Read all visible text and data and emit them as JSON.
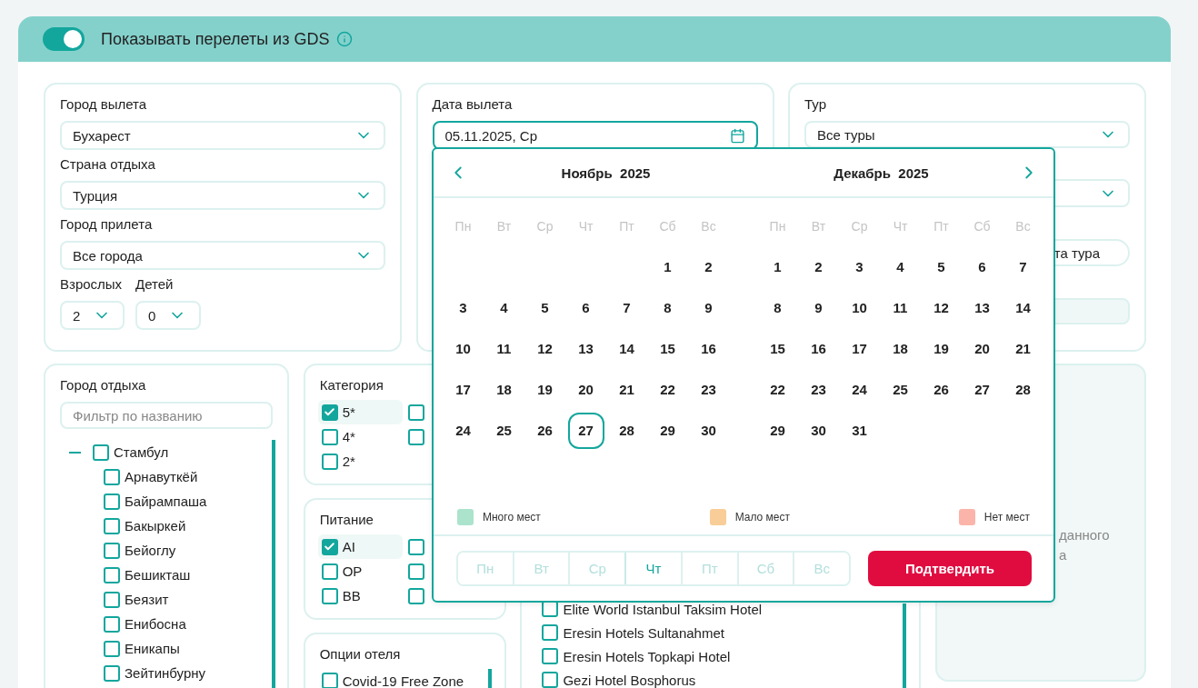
{
  "header": {
    "gds_toggle": {
      "on": true,
      "label": "Показывать перелеты из GDS"
    }
  },
  "search_panel": {
    "fields": [
      {
        "label": "Город вылета",
        "value": "Бухарест"
      },
      {
        "label": "Страна отдыха",
        "value": "Турция"
      },
      {
        "label": "Город прилета",
        "value": "Все города"
      }
    ],
    "adults": {
      "label": "Взрослых",
      "value": "2"
    },
    "children": {
      "label": "Детей",
      "value": "0"
    }
  },
  "date_panel": {
    "label": "Дата вылета",
    "value": "05.11.2025, Ср"
  },
  "tour_panel": {
    "label": "Тур",
    "value": "Все туры",
    "field_3_text": "та тура"
  },
  "resort_city": {
    "label": "Город отдыха",
    "placeholder": "Фильтр по названию",
    "tree": [
      {
        "label": "Стамбул",
        "checked": false,
        "expanded": true,
        "children": [
          {
            "label": "Арнавуткёй",
            "checked": false
          },
          {
            "label": "Байрампаша",
            "checked": false
          },
          {
            "label": "Бакыркей",
            "checked": false
          },
          {
            "label": "Бейоглу",
            "checked": false
          },
          {
            "label": "Бешикташ",
            "checked": false
          },
          {
            "label": "Беязит",
            "checked": false
          },
          {
            "label": "Енибосна",
            "checked": false
          },
          {
            "label": "Еникапы",
            "checked": false
          },
          {
            "label": "Зейтинбурну",
            "checked": false
          }
        ]
      }
    ]
  },
  "category": {
    "label": "Категория",
    "options": [
      {
        "label": "5*",
        "checked": true
      },
      {
        "label": "4*",
        "checked": false
      },
      {
        "label": "2*",
        "checked": false
      }
    ],
    "column_2": [
      {
        "checked": false
      },
      {
        "checked": false
      }
    ]
  },
  "meal": {
    "label": "Питание",
    "options": [
      {
        "label": "AI",
        "checked": true
      },
      {
        "label": "OP",
        "checked": false
      },
      {
        "label": "BB",
        "checked": false
      }
    ],
    "column_2": [
      {
        "checked": false
      },
      {
        "checked": false
      },
      {
        "checked": false
      }
    ]
  },
  "hotel_options": {
    "label": "Опции отеля",
    "options": [
      {
        "label": "Covid-19 Free Zone",
        "checked": false
      }
    ]
  },
  "hotels": [
    {
      "label": "Elite World Istanbul Taksim Hotel",
      "checked": false
    },
    {
      "label": "Eresin Hotels Sultanahmet",
      "checked": false
    },
    {
      "label": "Eresin Hotels Topkapi Hotel",
      "checked": false
    },
    {
      "label": "Gezi Hotel Bosphorus",
      "checked": false
    }
  ],
  "info_panel": {
    "lines": [
      "данного",
      "а"
    ]
  },
  "calendar": {
    "months": [
      {
        "title": "Ноябрь  2025",
        "weekdays": [
          "Пн",
          "Вт",
          "Ср",
          "Чт",
          "Пт",
          "Сб",
          "Вс"
        ],
        "weeks": [
          [
            {
              "day": "1",
              "selected": false
            },
            {
              "day": "2",
              "selected": false
            }
          ],
          [
            {
              "day": "3",
              "selected": false
            },
            {
              "day": "4",
              "selected": false
            },
            {
              "day": "5",
              "selected": false
            },
            {
              "day": "6",
              "selected": false
            },
            {
              "day": "7",
              "selected": false
            },
            {
              "day": "8",
              "selected": false
            },
            {
              "day": "9",
              "selected": false
            }
          ],
          [
            {
              "day": "10",
              "selected": false
            },
            {
              "day": "11",
              "selected": false
            },
            {
              "day": "12",
              "selected": false
            },
            {
              "day": "13",
              "selected": false
            },
            {
              "day": "14",
              "selected": false
            },
            {
              "day": "15",
              "selected": false
            },
            {
              "day": "16",
              "selected": false
            }
          ],
          [
            {
              "day": "17",
              "selected": false
            },
            {
              "day": "18",
              "selected": false
            },
            {
              "day": "19",
              "selected": false
            },
            {
              "day": "20",
              "selected": false
            },
            {
              "day": "21",
              "selected": false
            },
            {
              "day": "22",
              "selected": false
            },
            {
              "day": "23",
              "selected": false
            }
          ],
          [
            {
              "day": "24",
              "selected": false
            },
            {
              "day": "25",
              "selected": false
            },
            {
              "day": "26",
              "selected": false
            },
            {
              "day": "27",
              "selected": true
            },
            {
              "day": "28",
              "selected": false
            },
            {
              "day": "29",
              "selected": false
            },
            {
              "day": "30",
              "selected": false
            }
          ]
        ]
      },
      {
        "title": "Декабрь  2025",
        "weekdays": [
          "Пн",
          "Вт",
          "Ср",
          "Чт",
          "Пт",
          "Сб",
          "Вс"
        ],
        "weeks": [
          [
            {
              "day": "1",
              "selected": false
            },
            {
              "day": "2",
              "selected": false
            },
            {
              "day": "3",
              "selected": false
            },
            {
              "day": "4",
              "selected": false
            },
            {
              "day": "5",
              "selected": false
            },
            {
              "day": "6",
              "selected": false
            },
            {
              "day": "7",
              "selected": false
            }
          ],
          [
            {
              "day": "8",
              "selected": false
            },
            {
              "day": "9",
              "selected": false
            },
            {
              "day": "10",
              "selected": false
            },
            {
              "day": "11",
              "selected": false
            },
            {
              "day": "12",
              "selected": false
            },
            {
              "day": "13",
              "selected": false
            },
            {
              "day": "14",
              "selected": false
            }
          ],
          [
            {
              "day": "15",
              "selected": false
            },
            {
              "day": "16",
              "selected": false
            },
            {
              "day": "17",
              "selected": false
            },
            {
              "day": "18",
              "selected": false
            },
            {
              "day": "19",
              "selected": false
            },
            {
              "day": "20",
              "selected": false
            },
            {
              "day": "21",
              "selected": false
            }
          ],
          [
            {
              "day": "22",
              "selected": false
            },
            {
              "day": "23",
              "selected": false
            },
            {
              "day": "24",
              "selected": false
            },
            {
              "day": "25",
              "selected": false
            },
            {
              "day": "26",
              "selected": false
            },
            {
              "day": "27",
              "selected": false
            },
            {
              "day": "28",
              "selected": false
            }
          ],
          [
            {
              "day": "29",
              "selected": false
            },
            {
              "day": "30",
              "selected": false
            },
            {
              "day": "31",
              "selected": false
            }
          ]
        ]
      }
    ],
    "legend": [
      {
        "label": "Много мест",
        "color": "#ace3cd"
      },
      {
        "label": "Мало мест",
        "color": "#f8cd97"
      },
      {
        "label": "Нет мест",
        "color": "#fbb4aa"
      }
    ],
    "weekday_filter": [
      {
        "label": "Пн",
        "selected": false
      },
      {
        "label": "Вт",
        "selected": false
      },
      {
        "label": "Ср",
        "selected": false
      },
      {
        "label": "Чт",
        "selected": true
      },
      {
        "label": "Пт",
        "selected": false
      },
      {
        "label": "Сб",
        "selected": false
      },
      {
        "label": "Вс",
        "selected": false
      }
    ],
    "confirm_button": "Подтвердить"
  }
}
